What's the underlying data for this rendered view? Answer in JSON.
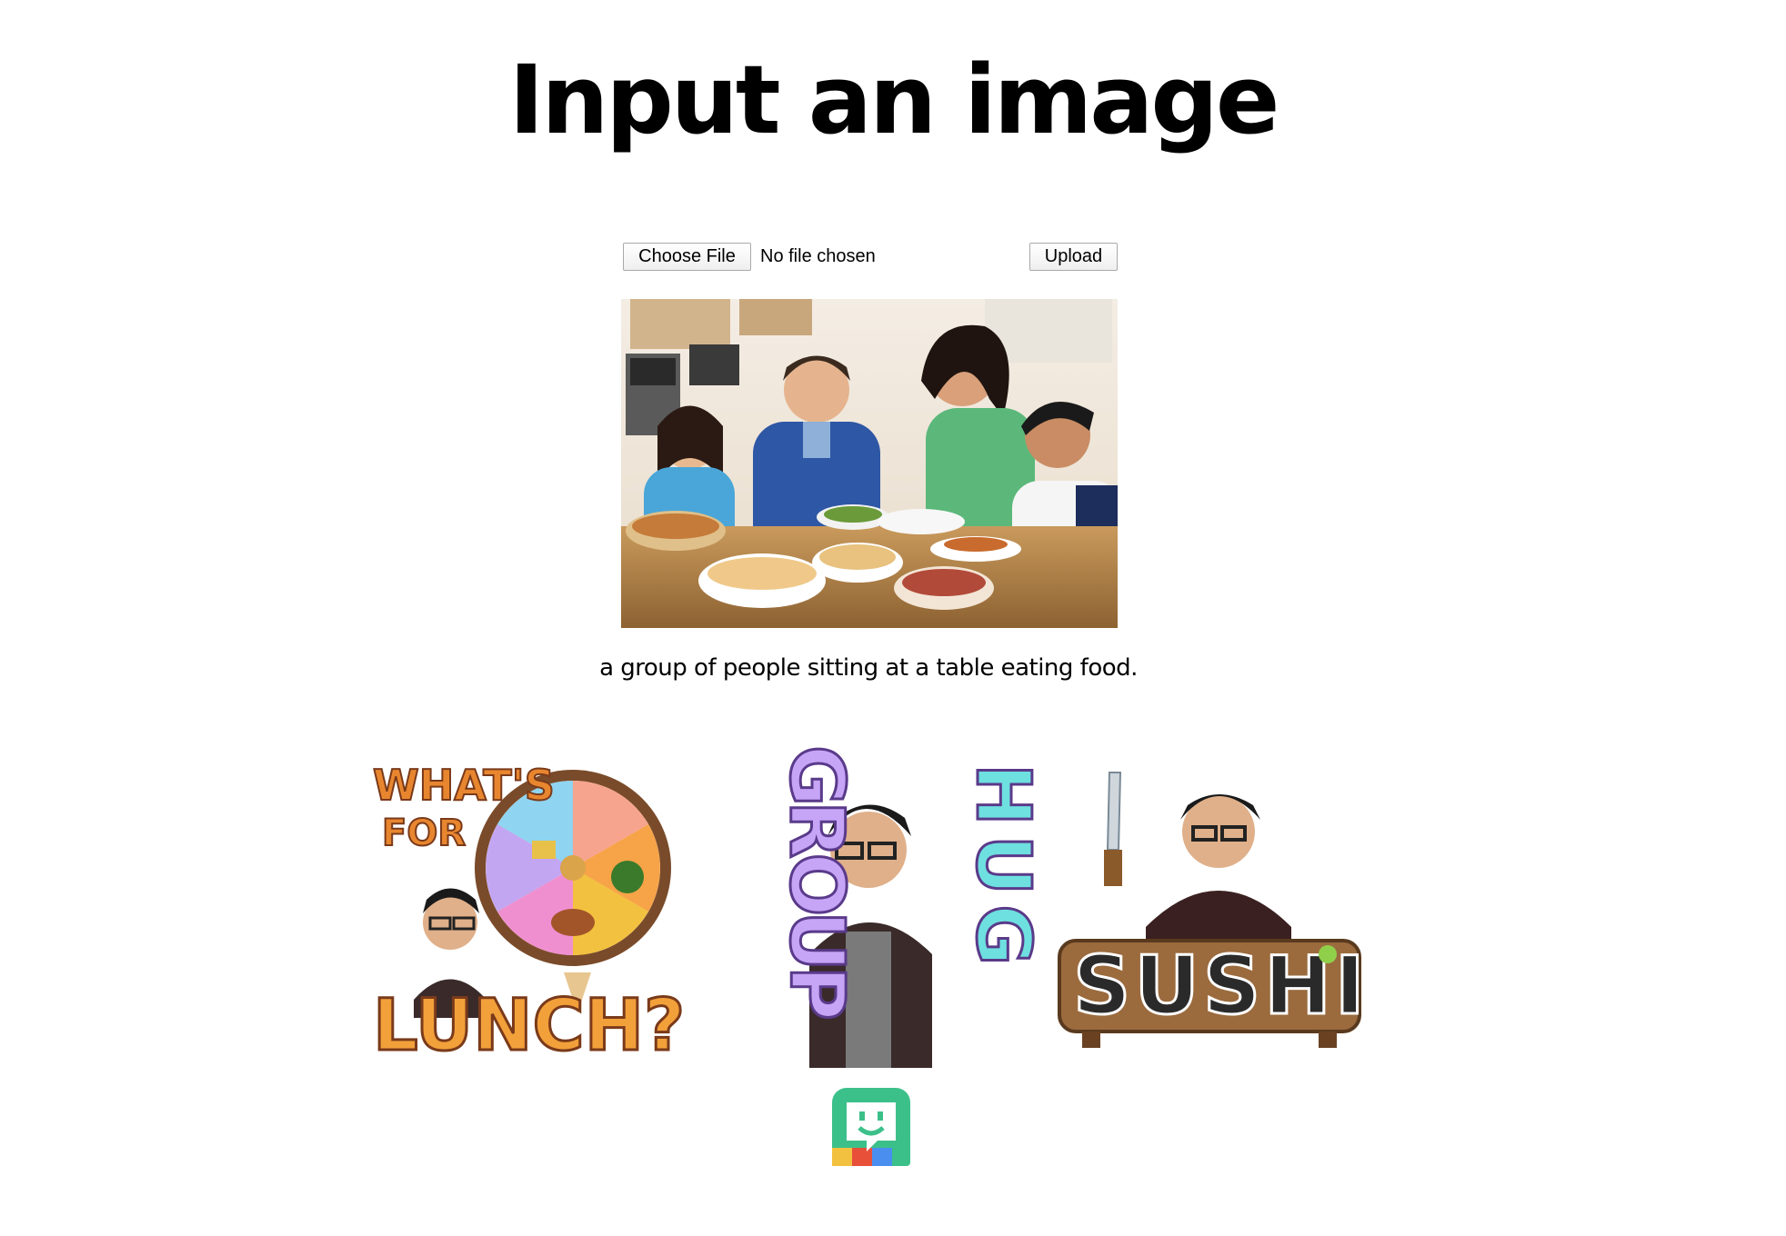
{
  "page": {
    "title": "Input an image"
  },
  "upload_form": {
    "choose_file_label": "Choose File",
    "file_status": "No file chosen",
    "upload_label": "Upload"
  },
  "result": {
    "caption": "a group of people sitting at a table eating food."
  },
  "stickers": [
    {
      "top_text": "WHAT'S",
      "mid_text": "FOR",
      "bottom_text": "LUNCH?"
    },
    {
      "left_text": "GROUP",
      "right_text": "HUG"
    },
    {
      "text": "SUSHI"
    }
  ],
  "colors": {
    "accent_green": "#3cc08a",
    "marquee_orange": "#e8862f",
    "bubble_purple": "#b88cf5",
    "bubble_pink": "#f28ad1",
    "bubble_cyan": "#6ee0e0",
    "board_brown": "#9b6b3e"
  },
  "icons": [
    "bitmoji-logo-icon"
  ]
}
